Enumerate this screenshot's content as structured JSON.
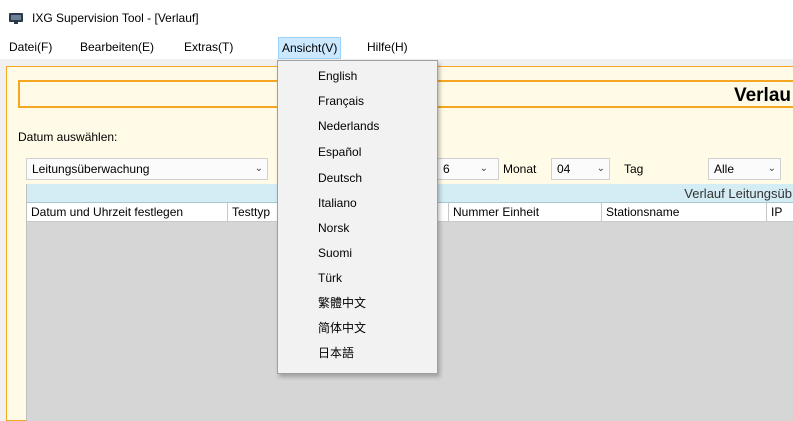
{
  "window": {
    "title": "IXG Supervision Tool - [Verlauf]"
  },
  "menubar": {
    "items": [
      {
        "label": "Datei(F)"
      },
      {
        "label": "Bearbeiten(E)"
      },
      {
        "label": "Extras(T)"
      },
      {
        "label": "Ansicht(V)",
        "active": true
      },
      {
        "label": "Hilfe(H)"
      }
    ]
  },
  "view_menu": {
    "items": [
      {
        "label": "English"
      },
      {
        "label": "Français"
      },
      {
        "label": "Nederlands"
      },
      {
        "label": "Español"
      },
      {
        "label": "Deutsch"
      },
      {
        "label": "Italiano"
      },
      {
        "label": "Norsk"
      },
      {
        "label": "Suomi"
      },
      {
        "label": "Türk"
      },
      {
        "label": "繁體中文"
      },
      {
        "label": "简体中文"
      },
      {
        "label": "日本語"
      }
    ]
  },
  "main": {
    "heading": "Verlau",
    "date_label": "Datum auswählen:",
    "filters": {
      "type_value": "Leitungsüberwachung",
      "year_value_fragment": "6",
      "month_label": "Monat",
      "month_value": "04",
      "day_label": "Tag",
      "day_value": "Alle"
    },
    "table": {
      "caption": "Verlauf Leitungsüb",
      "columns": [
        {
          "label": "Datum und Uhrzeit festlegen"
        },
        {
          "label": "Testtyp"
        },
        {
          "label": ""
        },
        {
          "label": "Nummer Einheit"
        },
        {
          "label": "Stationsname"
        },
        {
          "label": "IP"
        }
      ]
    }
  },
  "colors": {
    "accent_orange": "#f5a623",
    "panel_cream": "#fffbe6",
    "menu_highlight": "#cce8ff",
    "table_caption_blue": "#d4ecf4"
  },
  "icons": {
    "app": "app-icon",
    "dropdown_arrow": "chevron-down-icon"
  }
}
